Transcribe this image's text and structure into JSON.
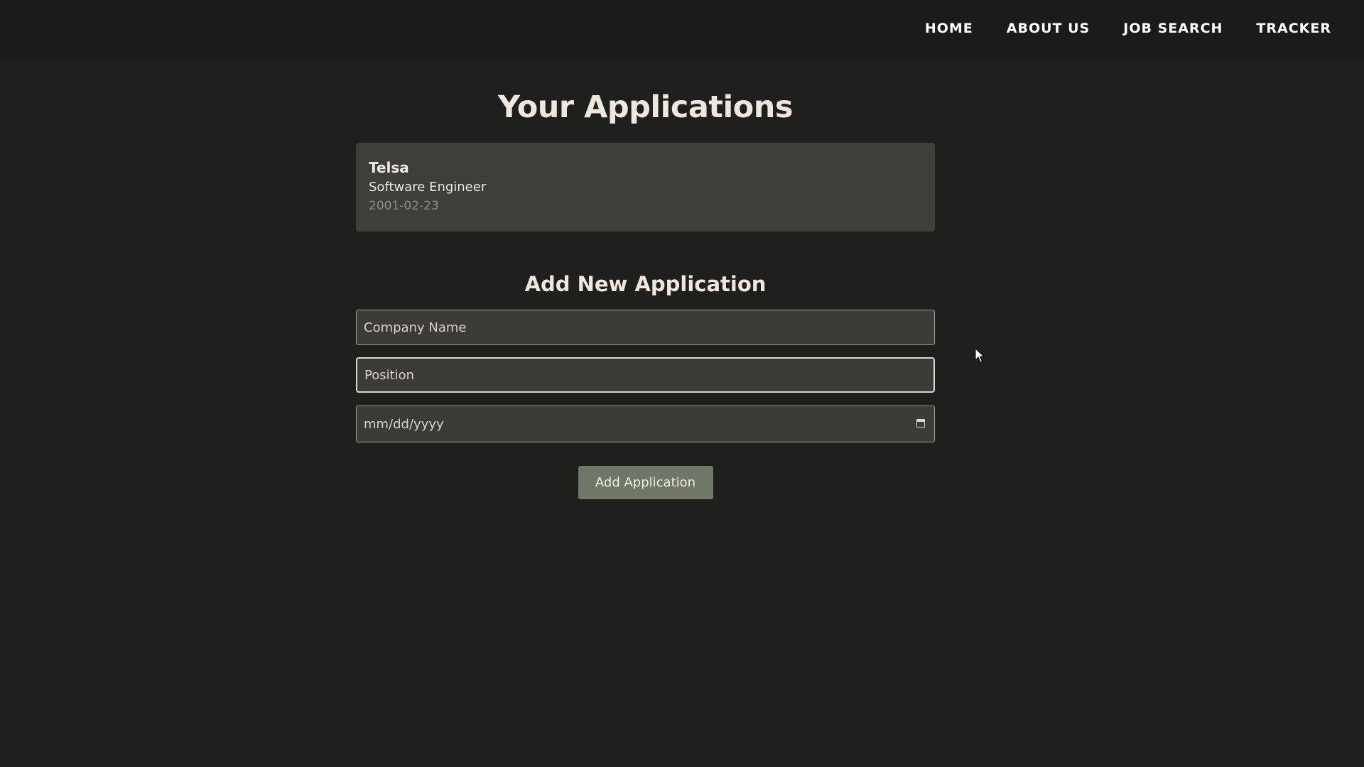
{
  "nav": {
    "items": [
      {
        "label": "HOME"
      },
      {
        "label": "ABOUT US"
      },
      {
        "label": "JOB SEARCH"
      },
      {
        "label": "TRACKER"
      }
    ]
  },
  "main": {
    "title": "Your Applications",
    "applications": [
      {
        "company": "Telsa",
        "position": "Software Engineer",
        "date": "2001-02-23"
      }
    ]
  },
  "form": {
    "title": "Add New Application",
    "company_placeholder": "Company Name",
    "position_placeholder": "Position",
    "date_placeholder": "mm/dd/yyyy",
    "submit_label": "Add Application",
    "calendar_icon": "calendar-icon"
  },
  "colors": {
    "background": "#1f201e",
    "header": "#1b1c1a",
    "card": "#3e3f3a",
    "button": "#6f7766"
  }
}
